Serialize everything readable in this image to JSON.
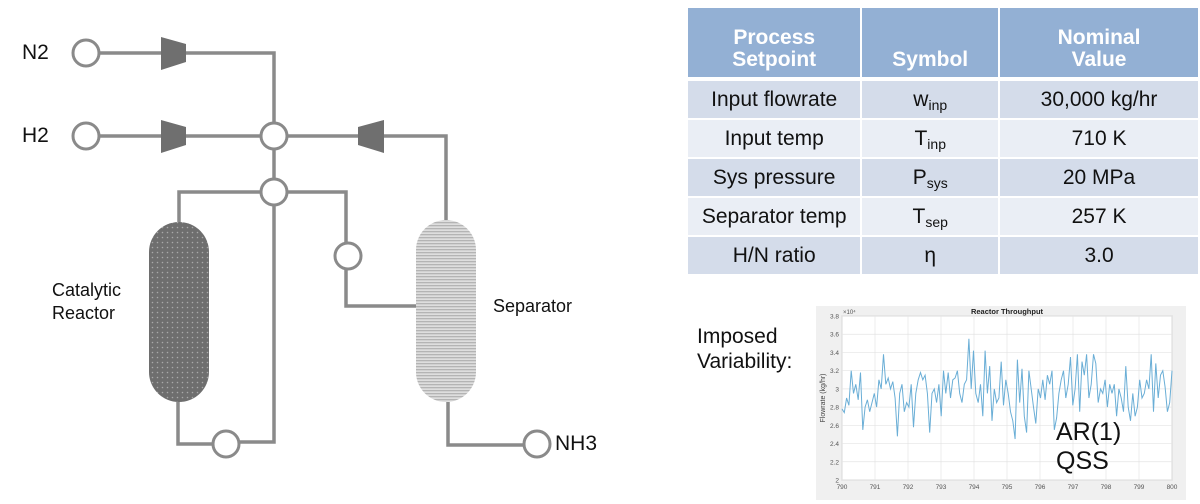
{
  "diagram": {
    "streams": {
      "n2": "N2",
      "h2": "H2",
      "nh3": "NH3"
    },
    "units": {
      "reactor": "Catalytic Reactor",
      "reactor_lines": [
        "Catalytic",
        "Reactor"
      ],
      "separator": "Separator"
    },
    "colors": {
      "pipe": "#8a8a8a",
      "compressor": "#6f6f6f",
      "reactor_fill": "#6e6e6e",
      "separator_fill": "#c8c8c8"
    }
  },
  "setpoint_table": {
    "headers": [
      {
        "line1": "Process",
        "line2": "Setpoint"
      },
      {
        "line1": "",
        "line2": "Symbol"
      },
      {
        "line1": "Nominal",
        "line2": "Value"
      }
    ],
    "rows": [
      {
        "setpoint": "Input flowrate",
        "symbol": "w",
        "symbol_sub": "inp",
        "value": "30,000 kg/hr"
      },
      {
        "setpoint": "Input temp",
        "symbol": "T",
        "symbol_sub": "inp",
        "value": "710 K"
      },
      {
        "setpoint": "Sys pressure",
        "symbol": "P",
        "symbol_sub": "sys",
        "value": "20 MPa"
      },
      {
        "setpoint": "Separator temp",
        "symbol": "T",
        "symbol_sub": "sep",
        "value": "257 K"
      },
      {
        "setpoint": "H/N ratio",
        "symbol": "η",
        "symbol_sub": "",
        "value": "3.0"
      }
    ],
    "colors": {
      "header_bg": "#93b0d4",
      "row_odd": "#d4dcea",
      "row_even": "#eaeef5"
    }
  },
  "variability": {
    "label_line1": "Imposed",
    "label_line2": "Variability:",
    "note_line1": "AR(1)",
    "note_line2": "QSS"
  },
  "chart_data": {
    "type": "line",
    "title": "Reactor Throughput",
    "xlabel": "",
    "ylabel": "Flowrate (kg/hr)",
    "y_exponent_label": "×10⁴",
    "xlim": [
      790,
      800
    ],
    "ylim": [
      2.0,
      3.8
    ],
    "xticks": [
      790,
      791,
      792,
      793,
      794,
      795,
      796,
      797,
      798,
      799,
      800
    ],
    "yticks": [
      2,
      2.2,
      2.4,
      2.6,
      2.8,
      3,
      3.2,
      3.4,
      3.6,
      3.8
    ],
    "ytick_labels": [
      "2",
      "2.2",
      "2.4",
      "2.6",
      "2.8",
      "3",
      "3.2",
      "3.4",
      "3.6",
      "3.8"
    ],
    "grid": true,
    "line_color": "#6aaed6",
    "series": [
      {
        "name": "Reactor Throughput",
        "x_start": 790,
        "x_step": 0.05,
        "values": [
          2.78,
          2.74,
          2.9,
          2.82,
          3.2,
          2.95,
          3.05,
          2.88,
          3.18,
          2.55,
          2.8,
          2.88,
          2.75,
          2.85,
          2.95,
          2.8,
          3.1,
          3.0,
          3.38,
          3.05,
          3.12,
          3.0,
          3.08,
          2.9,
          2.48,
          2.95,
          3.05,
          2.75,
          2.85,
          2.8,
          3.05,
          2.58,
          2.95,
          3.1,
          3.18,
          3.1,
          3.15,
          2.95,
          2.52,
          2.95,
          3.0,
          2.85,
          3.05,
          2.7,
          3.2,
          2.95,
          3.18,
          2.9,
          3.1,
          3.12,
          3.2,
          2.95,
          2.85,
          3.05,
          3.1,
          3.55,
          3.0,
          3.42,
          2.95,
          2.85,
          3.05,
          2.7,
          3.42,
          2.95,
          3.25,
          2.65,
          3.0,
          2.85,
          2.9,
          3.3,
          2.82,
          3.1,
          2.95,
          2.75,
          2.65,
          2.45,
          3.32,
          2.85,
          3.22,
          2.7,
          2.52,
          3.2,
          3.0,
          2.8,
          2.62,
          3.0,
          2.9,
          3.1,
          2.88,
          3.15,
          3.05,
          3.2,
          2.55,
          2.68,
          2.95,
          3.1,
          3.2,
          2.9,
          3.05,
          3.35,
          2.82,
          3.0,
          3.38,
          2.75,
          3.3,
          3.15,
          3.38,
          2.9,
          3.05,
          3.38,
          3.28,
          2.85,
          3.0,
          2.95,
          3.1,
          2.8,
          3.05,
          2.95,
          3.05,
          2.7,
          3.0,
          2.9,
          2.75,
          3.25,
          2.8,
          2.65,
          2.95,
          2.7,
          2.8,
          3.1,
          2.9,
          2.95,
          3.1,
          3.0,
          3.38,
          2.75,
          3.28,
          2.9,
          3.15,
          3.2,
          3.02,
          2.75,
          2.85,
          3.2
        ]
      }
    ]
  }
}
